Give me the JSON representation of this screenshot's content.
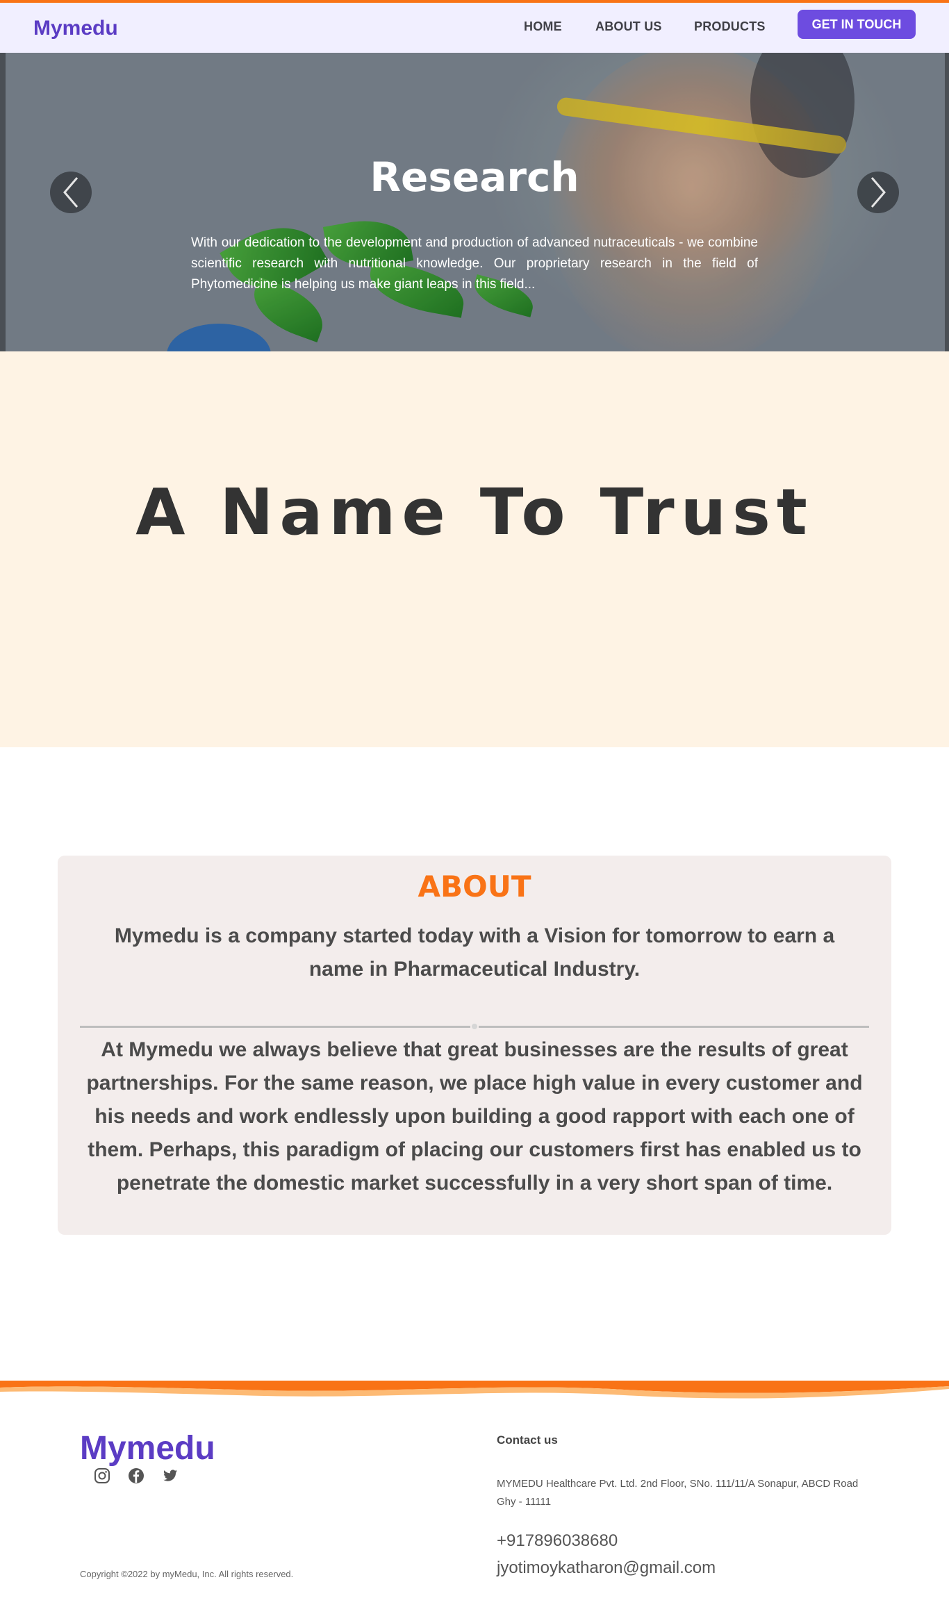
{
  "nav": {
    "brand": "Mymedu",
    "links": [
      "HOME",
      "ABOUT US",
      "PRODUCTS"
    ],
    "cta": "GET IN TOUCH"
  },
  "hero": {
    "title": "Research",
    "text": "With our dedication to the development and production of advanced nutraceuticals - we combine scientific research with nutritional knowledge. Our proprietary research in the field of Phytomedicine is helping us make giant leaps in this field..."
  },
  "trust": {
    "heading": "A Name To Trust"
  },
  "about": {
    "title": "ABOUT",
    "lead": "Mymedu is a company started today with a Vision for tomorrow to earn a name in Pharmaceutical Industry.",
    "body": "At Mymedu we always believe that great businesses are the results of great partnerships. For the same reason, we place high value in every customer and his needs and work endlessly upon building a good rapport with each one of them. Perhaps, this paradigm of placing our customers first has enabled us to penetrate the domestic market successfully in a very short span of time."
  },
  "footer": {
    "brand": "Mymedu",
    "social_icons": [
      "instagram-icon",
      "facebook-icon",
      "twitter-icon"
    ],
    "copyright": "Copyright ©2022 by myMedu, Inc. All rights reserved.",
    "contact_title": "Contact us",
    "address": "MYMEDU Healthcare Pvt. Ltd. 2nd Floor, SNo. 111/11/A Sonapur, ABCD Road Ghy - 11111",
    "phone": "+917896038680",
    "email": "jyotimoykatharon@gmail.com"
  },
  "colors": {
    "accent_orange": "#f97316",
    "brand_purple": "#5b3cc4",
    "button_purple": "#6d4ce0",
    "trust_background": "#fef3e4",
    "about_card_background": "#f3edec"
  }
}
